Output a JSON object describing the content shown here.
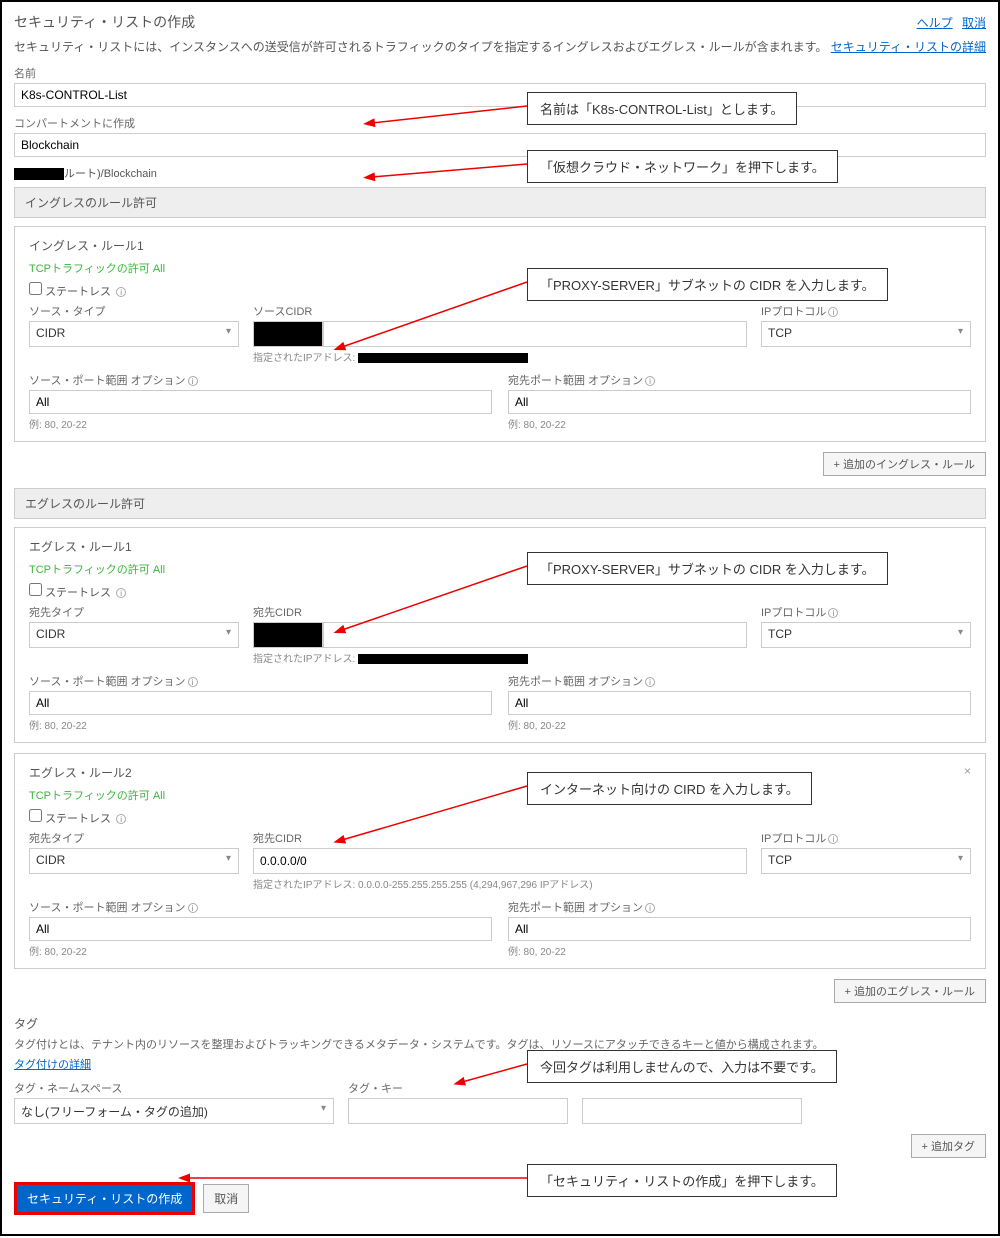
{
  "header": {
    "title": "セキュリティ・リストの作成",
    "help": "ヘルプ",
    "cancel": "取消",
    "description": "セキュリティ・リストには、インスタンスへの送受信が許可されるトラフィックのタイプを指定するイングレスおよびエグレス・ルールが含まれます。",
    "detail_link": "セキュリティ・リストの詳細"
  },
  "name": {
    "label": "名前",
    "value": "K8s-CONTROL-List"
  },
  "compartment": {
    "label": "コンパートメントに作成",
    "value": "Blockchain",
    "path_suffix": "ルート)/Blockchain"
  },
  "ingress": {
    "section_title": "イングレスのルール許可",
    "rule1": {
      "title": "イングレス・ルール1",
      "allow": "TCPトラフィックの許可 All",
      "stateless": "ステートレス",
      "source_type_label": "ソース・タイプ",
      "source_type": "CIDR",
      "source_cidr_label": "ソースCIDR",
      "cidr_hint_prefix": "指定されたIPアドレス:",
      "ip_proto_label": "IPプロトコル",
      "ip_proto": "TCP",
      "src_port_label": "ソース・ポート範囲 オプション",
      "src_port": "All",
      "dst_port_label": "宛先ポート範囲 オプション",
      "dst_port": "All",
      "port_hint": "例: 80, 20-22"
    },
    "add_button": "+ 追加のイングレス・ルール"
  },
  "egress": {
    "section_title": "エグレスのルール許可",
    "rule1": {
      "title": "エグレス・ルール1",
      "allow": "TCPトラフィックの許可 All",
      "stateless": "ステートレス",
      "dst_type_label": "宛先タイプ",
      "dst_type": "CIDR",
      "dst_cidr_label": "宛先CIDR",
      "cidr_hint_prefix": "指定されたIPアドレス:",
      "ip_proto_label": "IPプロトコル",
      "ip_proto": "TCP",
      "src_port_label": "ソース・ポート範囲 オプション",
      "src_port": "All",
      "dst_port_label": "宛先ポート範囲 オプション",
      "dst_port": "All",
      "port_hint": "例: 80, 20-22"
    },
    "rule2": {
      "title": "エグレス・ルール2",
      "allow": "TCPトラフィックの許可 All",
      "stateless": "ステートレス",
      "dst_type_label": "宛先タイプ",
      "dst_type": "CIDR",
      "dst_cidr_label": "宛先CIDR",
      "dst_cidr_value": "0.0.0.0/0",
      "cidr_hint": "指定されたIPアドレス: 0.0.0.0-255.255.255.255 (4,294,967,296 IPアドレス)",
      "ip_proto_label": "IPプロトコル",
      "ip_proto": "TCP",
      "src_port_label": "ソース・ポート範囲 オプション",
      "src_port": "All",
      "dst_port_label": "宛先ポート範囲 オプション",
      "dst_port": "All",
      "port_hint": "例: 80, 20-22"
    },
    "add_button": "+ 追加のエグレス・ルール"
  },
  "tags": {
    "title": "タグ",
    "desc": "タグ付けとは、テナント内のリソースを整理およびトラッキングできるメタデータ・システムです。タグは、リソースにアタッチできるキーと値から構成されます。",
    "link": "タグ付けの詳細",
    "ns_label": "タグ・ネームスペース",
    "ns_value": "なし(フリーフォーム・タグの追加)",
    "key_label": "タグ・キー",
    "add_button": "+ 追加タグ"
  },
  "footer": {
    "create": "セキュリティ・リストの作成",
    "cancel": "取消"
  },
  "callouts": {
    "c1": "名前は「K8s-CONTROL-List」とします。",
    "c2": "「仮想クラウド・ネットワーク」を押下します。",
    "c3": "「PROXY-SERVER」サブネットの CIDR を入力します。",
    "c4": "「PROXY-SERVER」サブネットの CIDR を入力します。",
    "c5": "インターネット向けの CIRD を入力します。",
    "c6": "今回タグは利用しませんので、入力は不要です。",
    "c7": "「セキュリティ・リストの作成」を押下します。"
  }
}
